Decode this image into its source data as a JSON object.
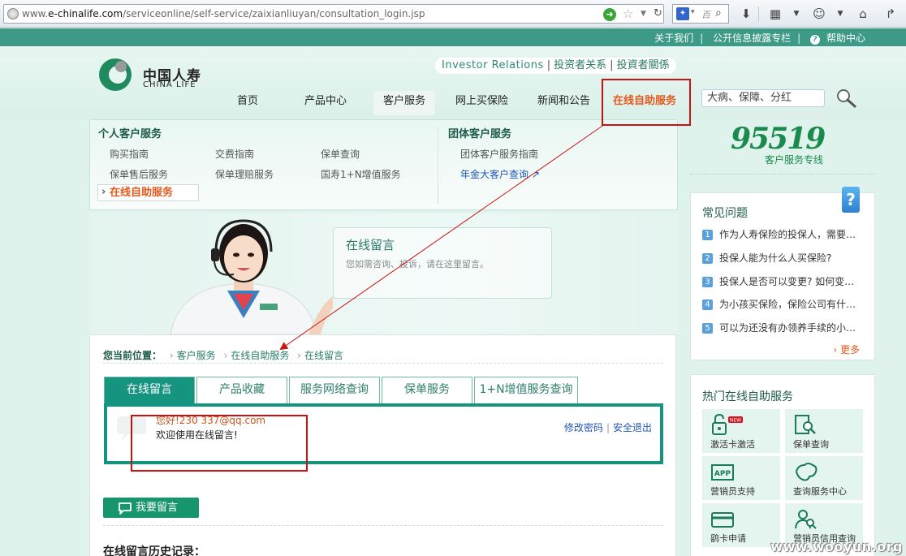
{
  "browser": {
    "url_prefix": "www.",
    "url_domain": "e-chinalife.com",
    "url_path": "/serviceonline/self-service/zaixianliuyan/consultation_login.jsp",
    "search_text": "百"
  },
  "top_bar": {
    "links": [
      "关于我们",
      "公开信息披露专栏",
      "帮助中心"
    ]
  },
  "header": {
    "logo_cn": "中国人寿",
    "logo_en": "CHINA LIFE",
    "ir_en": "Investor Relations",
    "ir_cn_simplified": "投资者关系",
    "ir_cn_traditional": "投資者關係",
    "nav": [
      "首页",
      "产品中心",
      "客户服务",
      "网上买保险",
      "新闻和公告",
      "在线自助服务"
    ],
    "search_value": "大病、保障、分红"
  },
  "dropdown": {
    "personal_title": "个人客户服务",
    "personal_links": [
      "购买指南",
      "交费指南",
      "保单查询",
      "保单售后服务",
      "保单理赔服务",
      "国寿1+N增值服务"
    ],
    "current": "在线自助服务",
    "group_title": "团体客户服务",
    "group_links": [
      "团体客户服务指南",
      "年金大客户查询"
    ]
  },
  "banner": {
    "title": "在线留言",
    "subtitle": "您如需咨询、投诉，请在这里留言。"
  },
  "content": {
    "crumb_label": "您当前位置：",
    "crumbs": [
      "客户服务",
      "在线自助服务",
      "在线留言"
    ],
    "tabs": [
      "在线留言",
      "产品收藏",
      "服务网络查询",
      "保单服务",
      "1+N增值服务查询"
    ],
    "greeting": "您好!230        337@qq.com",
    "welcome": "欢迎使用在线留言!",
    "change_password": "修改密码",
    "logout": "安全退出",
    "write_button": "我要留言",
    "history_title": "在线留言历史记录："
  },
  "sidebar": {
    "hotline_number": "95519",
    "hotline_label": "客户服务专线",
    "faq_title": "常见问题",
    "faq": [
      "作为人寿保险的投保人，需要…",
      "投保人能为什么人买保险?",
      "投保人是否可以变更? 如何变…",
      "为小孩买保险，保险公司有什…",
      "可以为还没有办领养手续的小…"
    ],
    "more": "更多",
    "hot_title": "热门在线自助服务",
    "hot_items": [
      "激活卡激活",
      "保单查询",
      "营销员支持",
      "查询服务中心",
      "鹞卡申请",
      "营销员信用查询"
    ],
    "new_badge": "NEW"
  },
  "watermark": "www.wooyun.org",
  "colors": {
    "brand_green": "#159480",
    "highlight_orange": "#e55a1c",
    "annotation_red": "#cc1111"
  }
}
